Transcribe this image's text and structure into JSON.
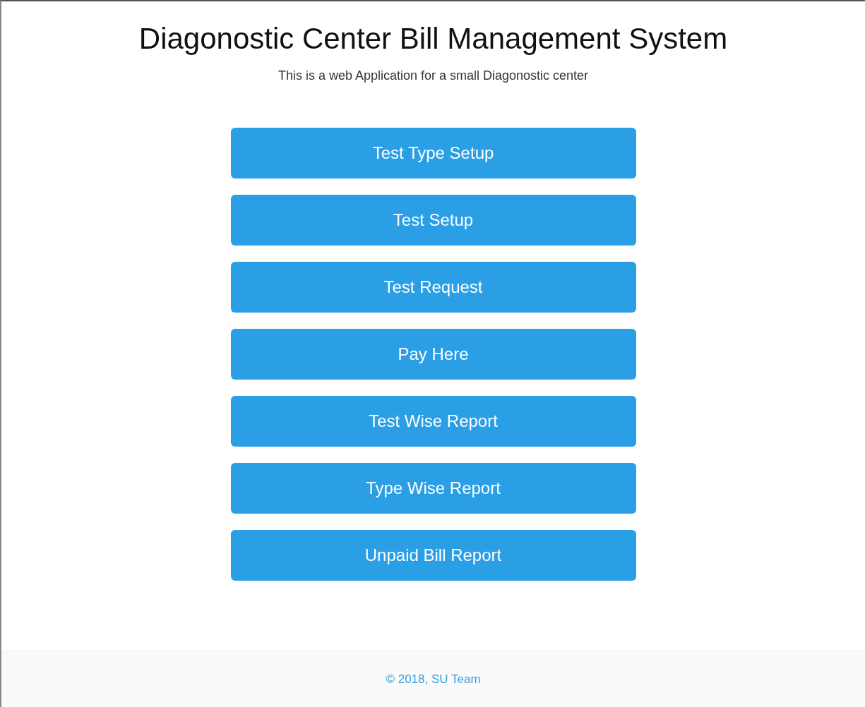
{
  "header": {
    "title": "Diagonostic Center Bill Management System",
    "subtitle": "This is a web Application for a small Diagonostic center"
  },
  "menu": [
    {
      "label": "Test Type Setup"
    },
    {
      "label": "Test Setup"
    },
    {
      "label": "Test Request"
    },
    {
      "label": "Pay Here"
    },
    {
      "label": "Test Wise Report"
    },
    {
      "label": "Type Wise Report"
    },
    {
      "label": "Unpaid Bill Report"
    }
  ],
  "footer": {
    "copyright": "© 2018, SU Team"
  }
}
